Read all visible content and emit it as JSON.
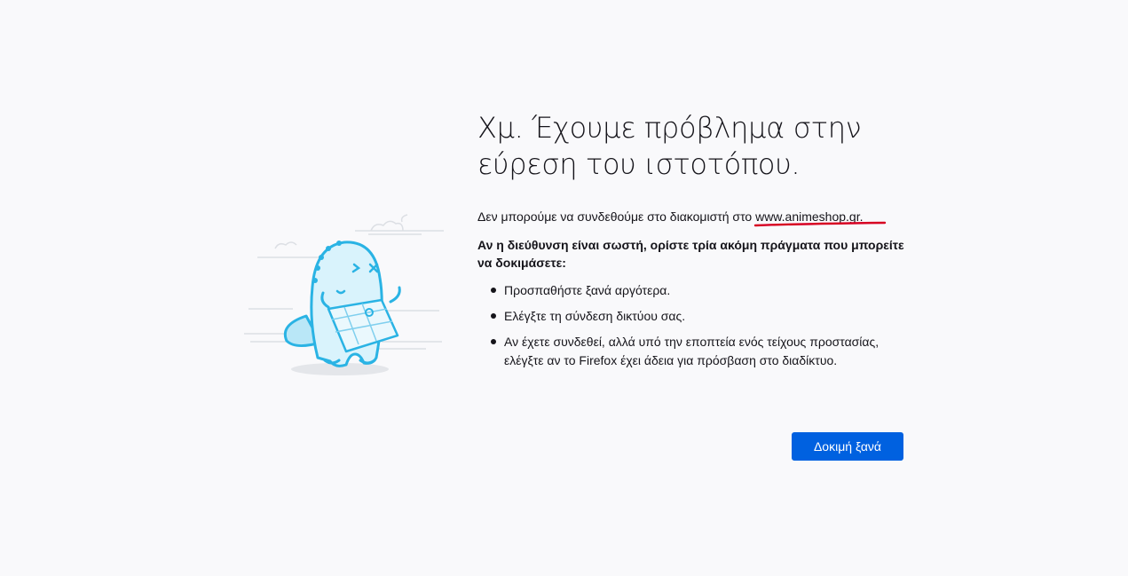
{
  "error": {
    "title_line1": "Χμ. Έχουμε πρόβλημα στην",
    "title_line2": "εύρεση του ιστοτόπου.",
    "description_prefix": "Δεν μπορούμε να συνδεθούμε στο διακομιστή στο ",
    "host": "www.animeshop.gr.",
    "subheading": "Αν η διεύθυνση είναι σωστή, ορίστε τρία ακόμη πράγματα που μπορείτε να δοκιμάσετε:",
    "tips": [
      "Προσπαθήστε ξανά αργότερα.",
      "Ελέγξτε τη σύνδεση δικτύου σας.",
      "Αν έχετε συνδεθεί, αλλά υπό την εποπτεία ενός τείχους προστασίας, ελέγξτε αν το Firefox έχει άδεια για πρόσβαση στο διαδίκτυο."
    ],
    "retry_label": "Δοκιμή ξανά"
  },
  "colors": {
    "accent": "#0061e0",
    "annotation_underline": "#d70022",
    "illustration_stroke": "#2ab3e4",
    "background": "#f9f9fb"
  },
  "icons": {
    "illustration": "confused-dinosaur-with-map-icon",
    "bullet": "bullet-dot-icon"
  }
}
